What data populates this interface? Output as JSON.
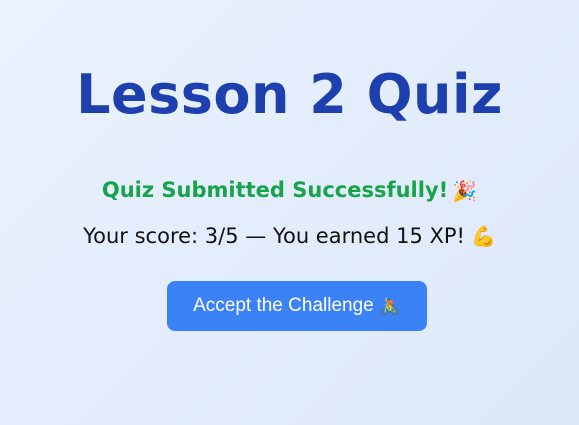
{
  "quiz": {
    "title": "Lesson 2 Quiz",
    "success_message": "Quiz Submitted Successfully!",
    "success_emoji": "🎉",
    "score_text": "Your score: 3/5 — You earned 15 XP!",
    "score_emoji": "💪",
    "score": 3,
    "max_score": 5,
    "xp_earned": 15,
    "button_label": "Accept the Challenge",
    "button_emoji": "🚴",
    "icons": {
      "success": "party-popper-icon",
      "score": "flexed-biceps-icon",
      "button": "cyclist-icon"
    }
  },
  "colors": {
    "title": "#1e40af",
    "success": "#16a34a",
    "button_bg": "#3b82f6",
    "button_text": "#ffffff",
    "background": "#e6effc"
  }
}
